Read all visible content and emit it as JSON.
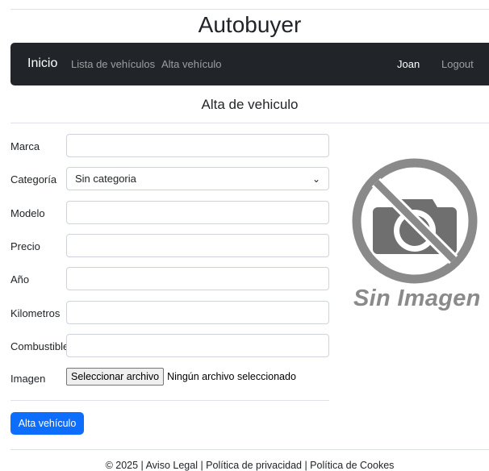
{
  "header": {
    "brand": "Autobuyer"
  },
  "nav": {
    "home": "Inicio",
    "links": [
      "Lista de vehículos",
      "Alta vehículo"
    ],
    "user": "Joan",
    "logout": "Logout"
  },
  "page": {
    "title": "Alta de vehiculo"
  },
  "form": {
    "labels": {
      "marca": "Marca",
      "categoria": "Categoría",
      "modelo": "Modelo",
      "precio": "Precio",
      "anio": "Año",
      "kilometros": "Kilometros",
      "combustible": "Combustible",
      "imagen": "Imagen"
    },
    "values": {
      "marca": "",
      "modelo": "",
      "precio": "",
      "anio": "",
      "kilometros": "",
      "combustible": ""
    },
    "categoria_selected": "Sin categoria",
    "file_button": "Seleccionar archivo",
    "file_status": "Ningún archivo seleccionado",
    "submit": "Alta vehículo"
  },
  "preview": {
    "text": "Sin Imagen"
  },
  "footer": {
    "text": "© 2025 | Aviso Legal | Política de privacidad | Política de Cookes"
  },
  "colors": {
    "navbar": "#212529",
    "primary": "#0d6efd",
    "placeholder_gray": "#8a8a8a"
  }
}
